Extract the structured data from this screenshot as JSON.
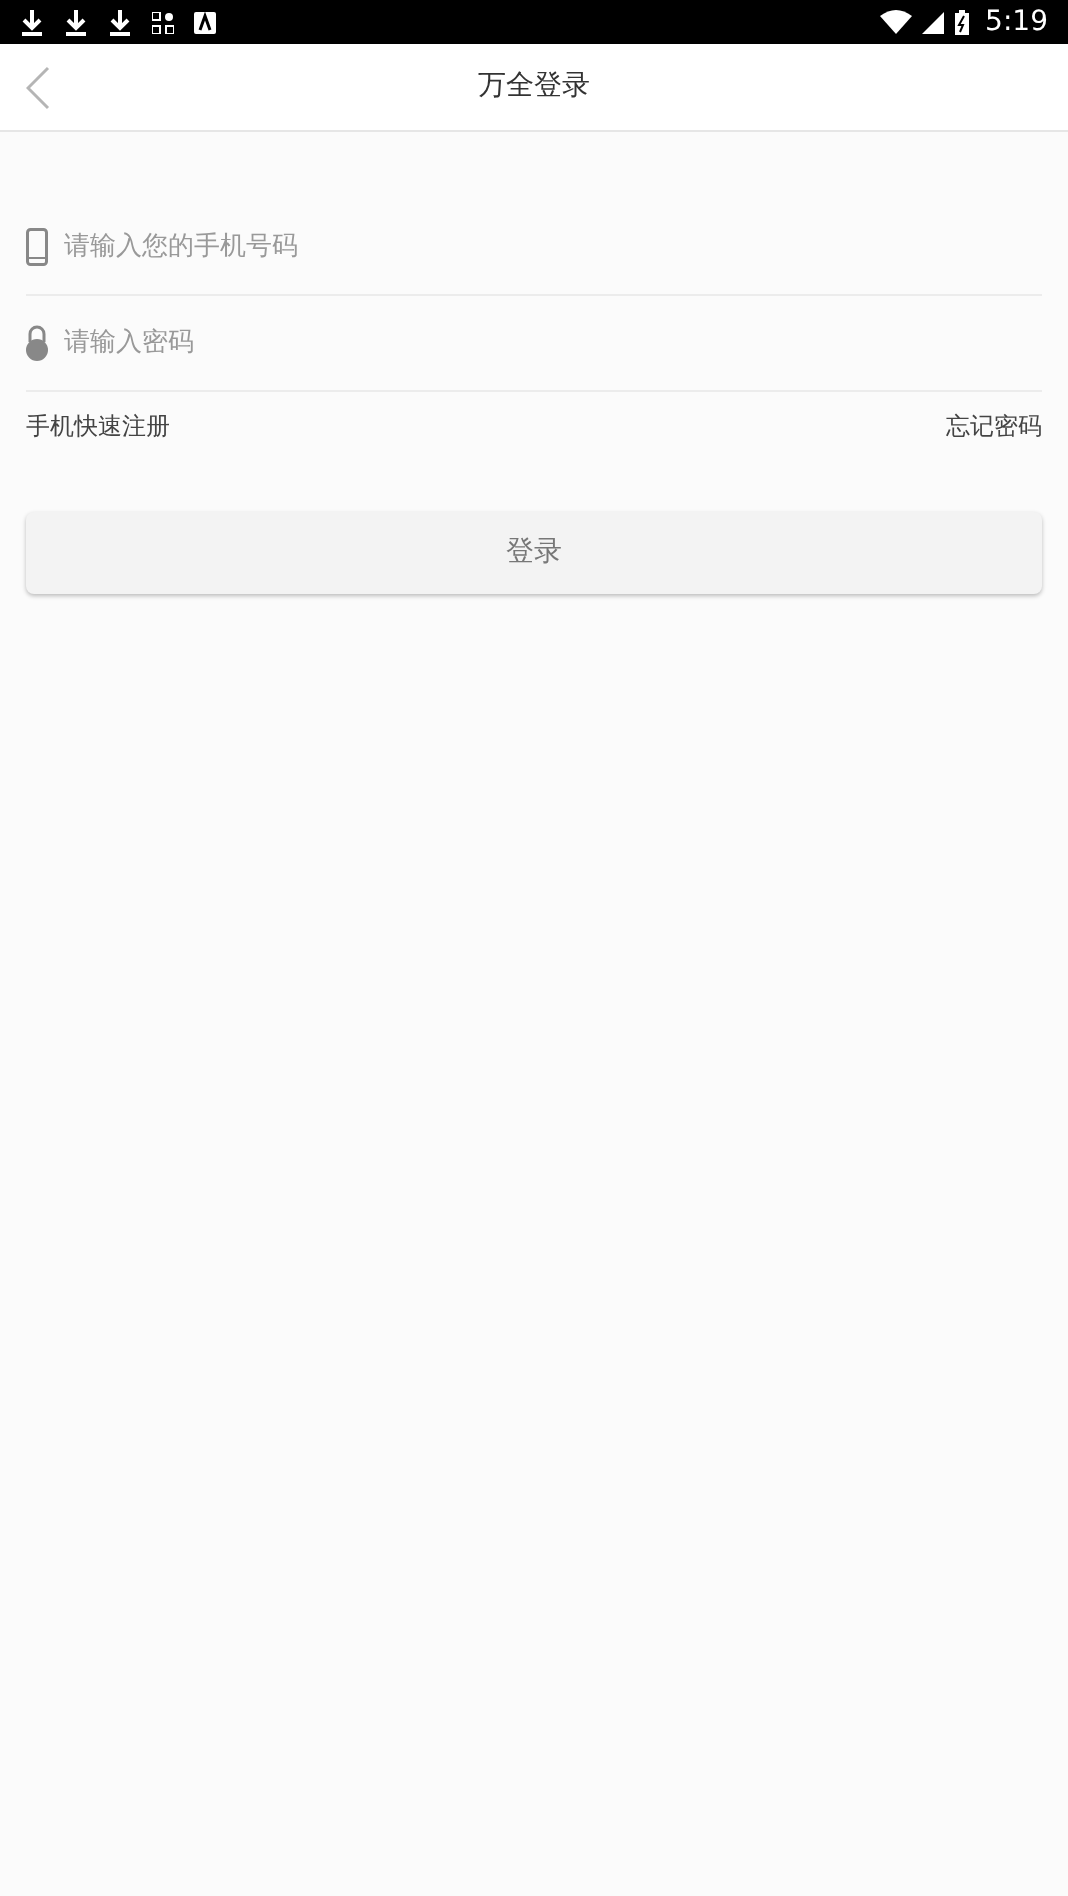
{
  "status_bar": {
    "time": "5:19"
  },
  "header": {
    "title": "万全登录"
  },
  "fields": [
    {
      "kind": "phone",
      "placeholder": "请输入您的手机号码"
    },
    {
      "kind": "password",
      "placeholder": "请输入密码"
    }
  ],
  "links": {
    "register": "手机快速注册",
    "forgot": "忘记密码"
  },
  "login_button": {
    "label": "登录"
  }
}
